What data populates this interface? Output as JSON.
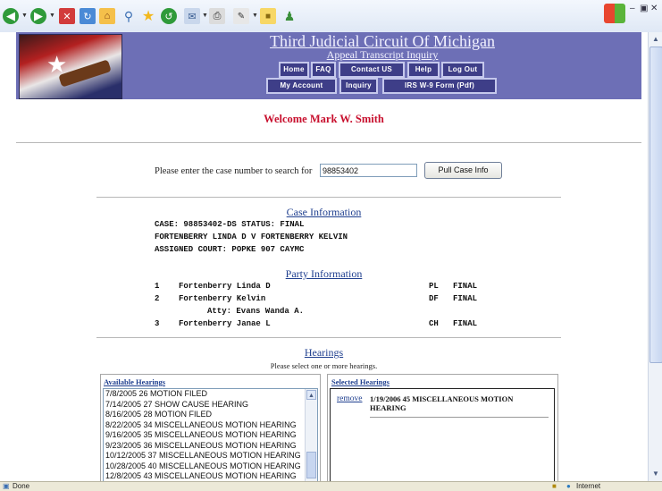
{
  "browser": {
    "toolbar_icons": [
      "back-icon",
      "forward-icon",
      "stop-icon",
      "refresh-icon",
      "home-icon",
      "search-icon",
      "favorites-icon",
      "history-icon",
      "mail-icon",
      "print-icon",
      "edit-icon",
      "folder-icon",
      "messenger-icon"
    ]
  },
  "banner": {
    "title": "Third Judicial Circuit Of Michigan",
    "subtitle": "Appeal Transcript Inquiry",
    "nav_row1": [
      "Home",
      "FAQ",
      "Contact US",
      "Help",
      "Log Out"
    ],
    "nav_row2": [
      "My Account",
      "Inquiry",
      "IRS W-9 Form (Pdf)"
    ]
  },
  "welcome": "Welcome Mark W. Smith",
  "search": {
    "label": "Please enter the case number to search for",
    "value": "98853402",
    "button": "Pull Case Info"
  },
  "case_info": {
    "heading": "Case Information",
    "lines": [
      "CASE: 98853402-DS STATUS: FINAL",
      "FORTENBERRY LINDA D V FORTENBERRY KELVIN",
      "ASSIGNED COURT: POPKE 907 CAYMC"
    ]
  },
  "party_info": {
    "heading": "Party Information",
    "parties": [
      {
        "num": "1",
        "name": "Fortenberry Linda D",
        "role": "PL",
        "status": "FINAL"
      },
      {
        "num": "2",
        "name": "Fortenberry Kelvin",
        "role": "DF",
        "status": "FINAL",
        "atty": "Atty: Evans Wanda A."
      },
      {
        "num": "3",
        "name": "Fortenberry Janae L",
        "role": "CH",
        "status": "FINAL"
      }
    ]
  },
  "hearings": {
    "heading": "Hearings",
    "note": "Please select one or more hearings.",
    "available_label": "Available Hearings",
    "selected_label": "Selected Hearings",
    "available": [
      "7/8/2005 26 MOTION FILED",
      "7/14/2005 27 SHOW CAUSE HEARING",
      "8/16/2005 28 MOTION FILED",
      "8/22/2005 34 MISCELLANEOUS MOTION HEARING",
      "9/16/2005 35 MISCELLANEOUS MOTION HEARING",
      "9/23/2005 36 MISCELLANEOUS MOTION HEARING",
      "10/12/2005 37 MISCELLANEOUS MOTION HEARING",
      "10/28/2005 40 MISCELLANEOUS MOTION HEARING",
      "12/8/2005 43 MISCELLANEOUS MOTION HEARING"
    ],
    "selected": [
      {
        "remove_label": "remove",
        "text": "1/19/2006 45 MISCELLANEOUS MOTION HEARING"
      }
    ]
  },
  "status_bar": {
    "left": "Done",
    "zone": "Internet"
  }
}
